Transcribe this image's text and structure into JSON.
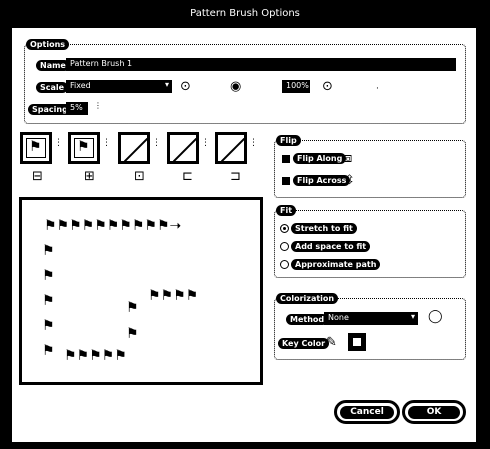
{
  "window": {
    "title": "Pattern Brush Options"
  },
  "options": {
    "group_label": "Options",
    "name_label": "Name",
    "name_value": "Pattern Brush 1",
    "scale_label": "Scale",
    "scale_mode": "Fixed",
    "scale_percent": "100%",
    "spacing_label": "Spacing",
    "spacing_value": "5%"
  },
  "flip": {
    "group_label": "Flip",
    "along_label": "Flip Along",
    "across_label": "Flip Across"
  },
  "fit": {
    "group_label": "Fit",
    "options": [
      "Stretch to fit",
      "Add space to fit",
      "Approximate path"
    ],
    "selected": "Stretch to fit"
  },
  "colorization": {
    "group_label": "Colorization",
    "method_label": "Method",
    "method_value": "None",
    "key_color_label": "Key Color"
  },
  "buttons": {
    "cancel": "Cancel",
    "ok": "OK"
  },
  "icons": {
    "tile_icons": [
      "side-tile-icon",
      "outer-corner-tile-icon",
      "inner-corner-tile-icon",
      "start-tile-icon",
      "end-tile-icon"
    ],
    "link_icon": "link-icon",
    "eyedropper_icon": "eyedropper-icon",
    "info_icon": "bulb-icon"
  }
}
